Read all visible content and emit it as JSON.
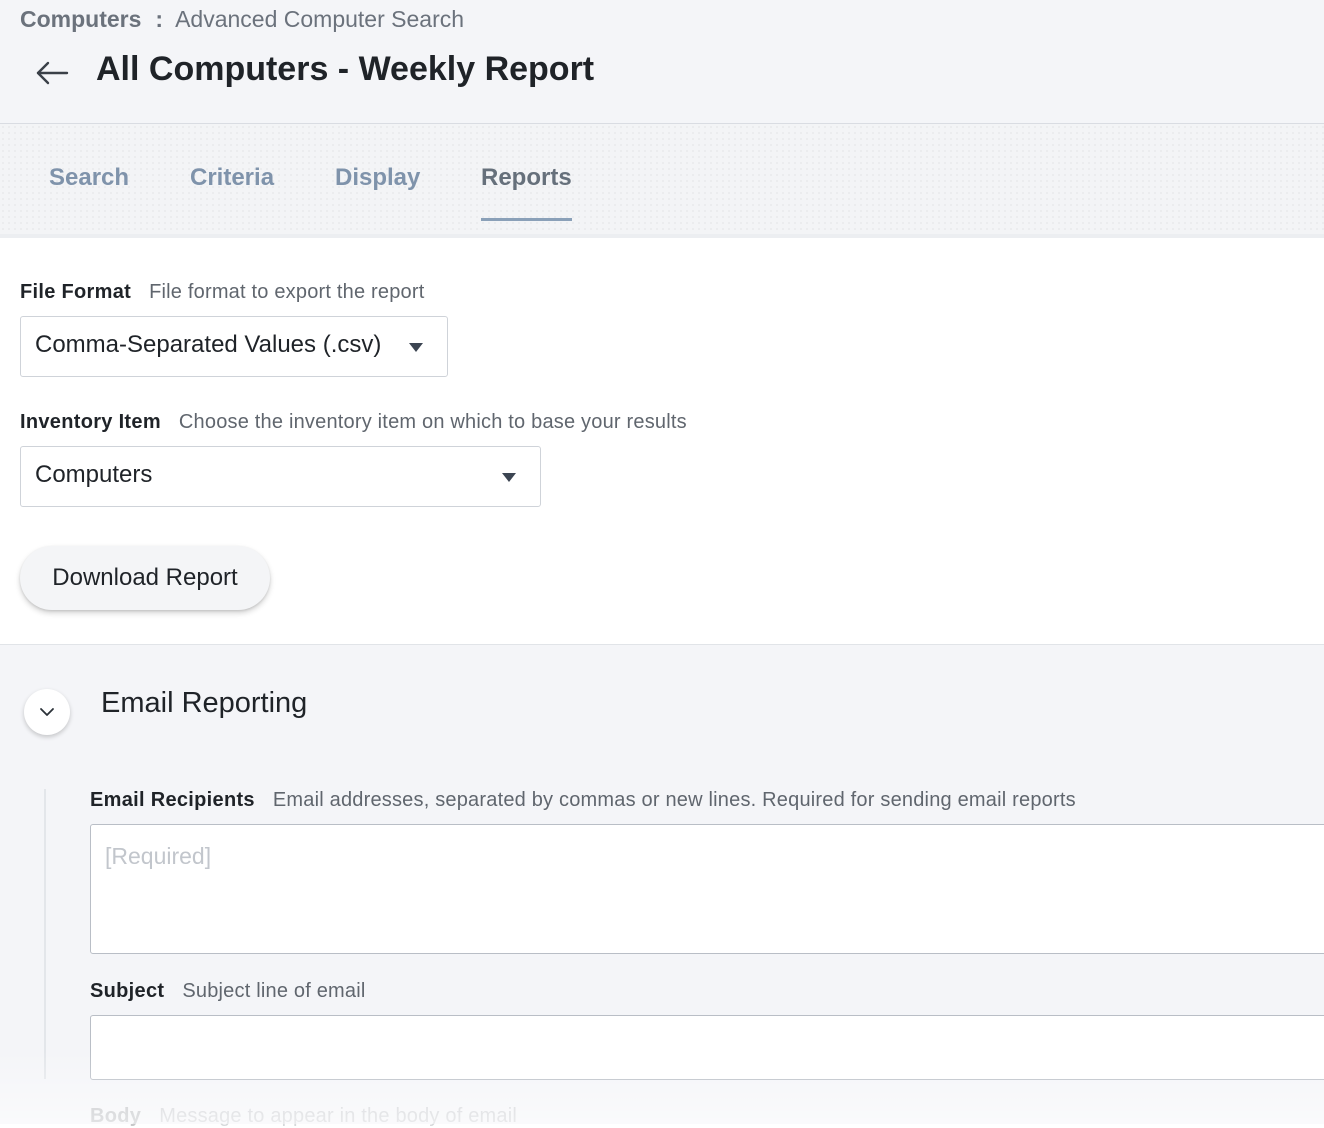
{
  "breadcrumb": {
    "root": "Computers",
    "separator": ":",
    "current": "Advanced Computer Search"
  },
  "header": {
    "back_icon": "arrow-left-icon",
    "title": "All Computers - Weekly Report"
  },
  "tabs": [
    {
      "label": "Search",
      "active": false
    },
    {
      "label": "Criteria",
      "active": false
    },
    {
      "label": "Display",
      "active": false
    },
    {
      "label": "Reports",
      "active": true
    }
  ],
  "file_format": {
    "label": "File Format",
    "help": "File format to export the report",
    "selected": "Comma-Separated Values (.csv)",
    "caret_icon": "caret-down-icon"
  },
  "inventory_item": {
    "label": "Inventory Item",
    "help": "Choose the inventory item on which to base your results",
    "selected": "Computers",
    "caret_icon": "caret-down-icon"
  },
  "actions": {
    "download_label": "Download Report"
  },
  "email_reporting": {
    "title": "Email Reporting",
    "toggle_icon": "chevron-down-icon",
    "recipients": {
      "label": "Email Recipients",
      "help": "Email addresses, separated by commas or new lines. Required for sending email reports",
      "placeholder": "[Required]",
      "value": ""
    },
    "subject": {
      "label": "Subject",
      "help": "Subject line of email",
      "value": ""
    },
    "body": {
      "label": "Body",
      "help": "Message to appear in the body of email"
    }
  },
  "colors": {
    "tab_inactive": "#7f93ab",
    "tab_active": "#66707b",
    "tab_underline": "#8aa0b8",
    "header_bg": "#f4f5f8"
  }
}
